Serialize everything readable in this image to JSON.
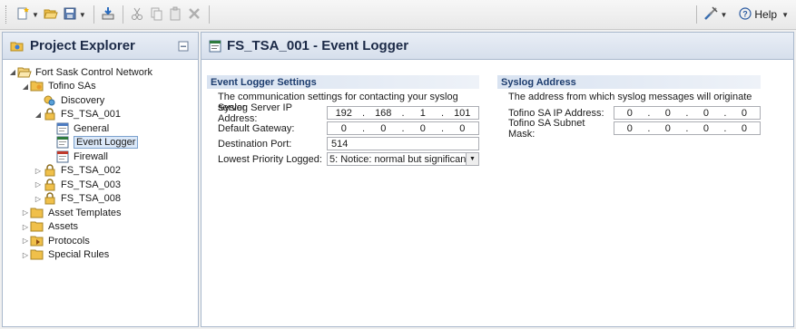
{
  "toolbar": {
    "help_label": "Help",
    "icons": [
      "new-file-icon",
      "open-folder-icon",
      "save-icon",
      "import-icon",
      "cut-icon",
      "copy-icon",
      "paste-icon",
      "delete-icon",
      "tools-icon",
      "help-icon"
    ]
  },
  "project_explorer": {
    "title": "Project Explorer",
    "tree": [
      {
        "label": "Fort Sask Control Network",
        "level": 0,
        "expanded": true,
        "has_children": true,
        "icon": "folder-open-icon"
      },
      {
        "label": "Tofino SAs",
        "level": 1,
        "expanded": true,
        "has_children": true,
        "icon": "folder-group-icon"
      },
      {
        "label": "Discovery",
        "level": 2,
        "expanded": false,
        "has_children": false,
        "icon": "discovery-icon"
      },
      {
        "label": "FS_TSA_001",
        "level": 2,
        "expanded": true,
        "has_children": true,
        "icon": "lock-icon"
      },
      {
        "label": "General",
        "level": 3,
        "expanded": false,
        "has_children": false,
        "icon": "general-icon"
      },
      {
        "label": "Event Logger",
        "level": 3,
        "expanded": false,
        "has_children": false,
        "icon": "event-logger-icon",
        "selected": true
      },
      {
        "label": "Firewall",
        "level": 3,
        "expanded": false,
        "has_children": false,
        "icon": "firewall-icon"
      },
      {
        "label": "FS_TSA_002",
        "level": 2,
        "expanded": false,
        "has_children": true,
        "icon": "lock-icon"
      },
      {
        "label": "FS_TSA_003",
        "level": 2,
        "expanded": false,
        "has_children": true,
        "icon": "lock-icon"
      },
      {
        "label": "FS_TSA_008",
        "level": 2,
        "expanded": false,
        "has_children": true,
        "icon": "lock-icon"
      },
      {
        "label": "Asset Templates",
        "level": 1,
        "expanded": false,
        "has_children": true,
        "icon": "folder-icon"
      },
      {
        "label": "Assets",
        "level": 1,
        "expanded": false,
        "has_children": true,
        "icon": "folder-icon"
      },
      {
        "label": "Protocols",
        "level": 1,
        "expanded": false,
        "has_children": true,
        "icon": "folder-protocols-icon"
      },
      {
        "label": "Special Rules",
        "level": 1,
        "expanded": false,
        "has_children": true,
        "icon": "folder-icon"
      }
    ]
  },
  "editor": {
    "title": "FS_TSA_001 - Event Logger",
    "settings": {
      "title": "Event Logger Settings",
      "description": "The communication settings for contacting your syslog server",
      "server_ip_label": "Syslog Server IP Address:",
      "server_ip": [
        "192",
        "168",
        "1",
        "101"
      ],
      "gateway_label": "Default Gateway:",
      "gateway": [
        "0",
        "0",
        "0",
        "0"
      ],
      "port_label": "Destination Port:",
      "port": "514",
      "priority_label": "Lowest Priority Logged:",
      "priority": "5: Notice: normal but significan"
    },
    "syslog": {
      "title": "Syslog Address",
      "description": "The address from which syslog messages will originate",
      "ip_label": "Tofino SA IP Address:",
      "ip": [
        "0",
        "0",
        "0",
        "0"
      ],
      "mask_label": "Tofino SA Subnet Mask:",
      "mask": [
        "0",
        "0",
        "0",
        "0"
      ]
    }
  }
}
